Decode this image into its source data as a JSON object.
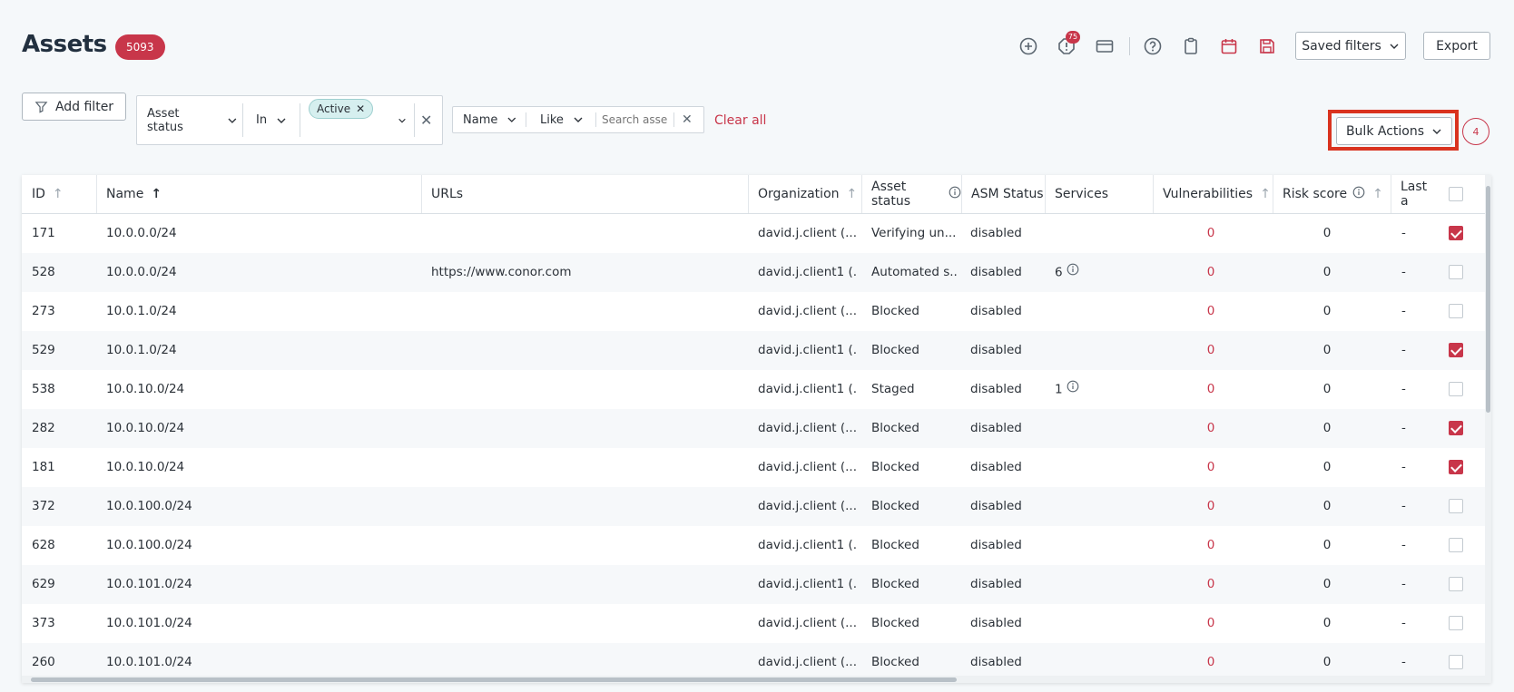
{
  "page": {
    "title": "Assets",
    "count": "5093"
  },
  "toolbar": {
    "alert_count": "75",
    "saved_filters_label": "Saved filters",
    "export_label": "Export"
  },
  "filters": {
    "add_filter_label": "Add filter",
    "filter1": {
      "field": "Asset status",
      "operator": "In",
      "chip": "Active"
    },
    "filter2": {
      "field": "Name",
      "operator": "Like",
      "placeholder": "Search asset"
    },
    "clear_all_label": "Clear all"
  },
  "bulk": {
    "label": "Bulk Actions",
    "selected_count": "4"
  },
  "table": {
    "columns": [
      "ID",
      "Name",
      "URLs",
      "Organization",
      "Asset status",
      "ASM Status",
      "Services",
      "Vulnerabilities",
      "Risk score",
      "Last a"
    ],
    "rows": [
      {
        "id": "171",
        "name": "10.0.0.0/24",
        "urls": "",
        "org": "david.j.client (...",
        "status": "Verifying un...",
        "asm": "disabled",
        "services": "",
        "vulns": "0",
        "risk": "0",
        "last": "-",
        "checked": true
      },
      {
        "id": "528",
        "name": "10.0.0.0/24",
        "urls": "https://www.conor.com",
        "org": "david.j.client1 (...",
        "status": "Automated s...",
        "asm": "disabled",
        "services": "6",
        "vulns": "0",
        "risk": "0",
        "last": "-",
        "checked": false
      },
      {
        "id": "273",
        "name": "10.0.1.0/24",
        "urls": "",
        "org": "david.j.client (...",
        "status": "Blocked",
        "asm": "disabled",
        "services": "",
        "vulns": "0",
        "risk": "0",
        "last": "-",
        "checked": false
      },
      {
        "id": "529",
        "name": "10.0.1.0/24",
        "urls": "",
        "org": "david.j.client1 (...",
        "status": "Blocked",
        "asm": "disabled",
        "services": "",
        "vulns": "0",
        "risk": "0",
        "last": "-",
        "checked": true
      },
      {
        "id": "538",
        "name": "10.0.10.0/24",
        "urls": "",
        "org": "david.j.client1 (...",
        "status": "Staged",
        "asm": "disabled",
        "services": "1",
        "vulns": "0",
        "risk": "0",
        "last": "-",
        "checked": false
      },
      {
        "id": "282",
        "name": "10.0.10.0/24",
        "urls": "",
        "org": "david.j.client (...",
        "status": "Blocked",
        "asm": "disabled",
        "services": "",
        "vulns": "0",
        "risk": "0",
        "last": "-",
        "checked": true
      },
      {
        "id": "181",
        "name": "10.0.10.0/24",
        "urls": "",
        "org": "david.j.client (...",
        "status": "Blocked",
        "asm": "disabled",
        "services": "",
        "vulns": "0",
        "risk": "0",
        "last": "-",
        "checked": true
      },
      {
        "id": "372",
        "name": "10.0.100.0/24",
        "urls": "",
        "org": "david.j.client (...",
        "status": "Blocked",
        "asm": "disabled",
        "services": "",
        "vulns": "0",
        "risk": "0",
        "last": "-",
        "checked": false
      },
      {
        "id": "628",
        "name": "10.0.100.0/24",
        "urls": "",
        "org": "david.j.client1 (...",
        "status": "Blocked",
        "asm": "disabled",
        "services": "",
        "vulns": "0",
        "risk": "0",
        "last": "-",
        "checked": false
      },
      {
        "id": "629",
        "name": "10.0.101.0/24",
        "urls": "",
        "org": "david.j.client1 (...",
        "status": "Blocked",
        "asm": "disabled",
        "services": "",
        "vulns": "0",
        "risk": "0",
        "last": "-",
        "checked": false
      },
      {
        "id": "373",
        "name": "10.0.101.0/24",
        "urls": "",
        "org": "david.j.client (...",
        "status": "Blocked",
        "asm": "disabled",
        "services": "",
        "vulns": "0",
        "risk": "0",
        "last": "-",
        "checked": false
      },
      {
        "id": "260",
        "name": "10.0.101.0/24",
        "urls": "",
        "org": "david.j.client (...",
        "status": "Blocked",
        "asm": "disabled",
        "services": "",
        "vulns": "0",
        "risk": "0",
        "last": "-",
        "checked": false
      }
    ]
  },
  "colors": {
    "accent": "#c8364a",
    "highlight": "#d9331f",
    "chip": "#d6efef"
  }
}
